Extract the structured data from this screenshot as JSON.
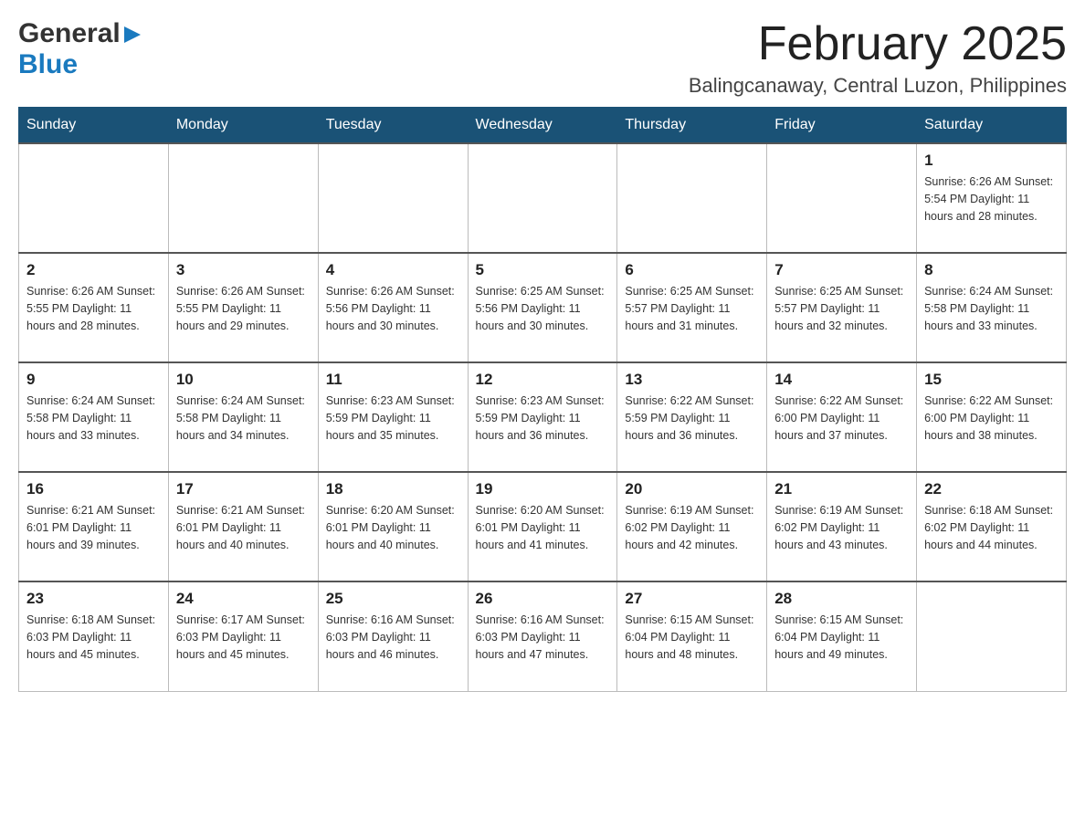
{
  "header": {
    "logo_general": "General",
    "logo_blue": "Blue",
    "month_title": "February 2025",
    "location": "Balingcanaway, Central Luzon, Philippines"
  },
  "days_of_week": [
    "Sunday",
    "Monday",
    "Tuesday",
    "Wednesday",
    "Thursday",
    "Friday",
    "Saturday"
  ],
  "weeks": [
    {
      "days": [
        {
          "number": "",
          "info": ""
        },
        {
          "number": "",
          "info": ""
        },
        {
          "number": "",
          "info": ""
        },
        {
          "number": "",
          "info": ""
        },
        {
          "number": "",
          "info": ""
        },
        {
          "number": "",
          "info": ""
        },
        {
          "number": "1",
          "info": "Sunrise: 6:26 AM\nSunset: 5:54 PM\nDaylight: 11 hours and 28 minutes."
        }
      ]
    },
    {
      "days": [
        {
          "number": "2",
          "info": "Sunrise: 6:26 AM\nSunset: 5:55 PM\nDaylight: 11 hours and 28 minutes."
        },
        {
          "number": "3",
          "info": "Sunrise: 6:26 AM\nSunset: 5:55 PM\nDaylight: 11 hours and 29 minutes."
        },
        {
          "number": "4",
          "info": "Sunrise: 6:26 AM\nSunset: 5:56 PM\nDaylight: 11 hours and 30 minutes."
        },
        {
          "number": "5",
          "info": "Sunrise: 6:25 AM\nSunset: 5:56 PM\nDaylight: 11 hours and 30 minutes."
        },
        {
          "number": "6",
          "info": "Sunrise: 6:25 AM\nSunset: 5:57 PM\nDaylight: 11 hours and 31 minutes."
        },
        {
          "number": "7",
          "info": "Sunrise: 6:25 AM\nSunset: 5:57 PM\nDaylight: 11 hours and 32 minutes."
        },
        {
          "number": "8",
          "info": "Sunrise: 6:24 AM\nSunset: 5:58 PM\nDaylight: 11 hours and 33 minutes."
        }
      ]
    },
    {
      "days": [
        {
          "number": "9",
          "info": "Sunrise: 6:24 AM\nSunset: 5:58 PM\nDaylight: 11 hours and 33 minutes."
        },
        {
          "number": "10",
          "info": "Sunrise: 6:24 AM\nSunset: 5:58 PM\nDaylight: 11 hours and 34 minutes."
        },
        {
          "number": "11",
          "info": "Sunrise: 6:23 AM\nSunset: 5:59 PM\nDaylight: 11 hours and 35 minutes."
        },
        {
          "number": "12",
          "info": "Sunrise: 6:23 AM\nSunset: 5:59 PM\nDaylight: 11 hours and 36 minutes."
        },
        {
          "number": "13",
          "info": "Sunrise: 6:22 AM\nSunset: 5:59 PM\nDaylight: 11 hours and 36 minutes."
        },
        {
          "number": "14",
          "info": "Sunrise: 6:22 AM\nSunset: 6:00 PM\nDaylight: 11 hours and 37 minutes."
        },
        {
          "number": "15",
          "info": "Sunrise: 6:22 AM\nSunset: 6:00 PM\nDaylight: 11 hours and 38 minutes."
        }
      ]
    },
    {
      "days": [
        {
          "number": "16",
          "info": "Sunrise: 6:21 AM\nSunset: 6:01 PM\nDaylight: 11 hours and 39 minutes."
        },
        {
          "number": "17",
          "info": "Sunrise: 6:21 AM\nSunset: 6:01 PM\nDaylight: 11 hours and 40 minutes."
        },
        {
          "number": "18",
          "info": "Sunrise: 6:20 AM\nSunset: 6:01 PM\nDaylight: 11 hours and 40 minutes."
        },
        {
          "number": "19",
          "info": "Sunrise: 6:20 AM\nSunset: 6:01 PM\nDaylight: 11 hours and 41 minutes."
        },
        {
          "number": "20",
          "info": "Sunrise: 6:19 AM\nSunset: 6:02 PM\nDaylight: 11 hours and 42 minutes."
        },
        {
          "number": "21",
          "info": "Sunrise: 6:19 AM\nSunset: 6:02 PM\nDaylight: 11 hours and 43 minutes."
        },
        {
          "number": "22",
          "info": "Sunrise: 6:18 AM\nSunset: 6:02 PM\nDaylight: 11 hours and 44 minutes."
        }
      ]
    },
    {
      "days": [
        {
          "number": "23",
          "info": "Sunrise: 6:18 AM\nSunset: 6:03 PM\nDaylight: 11 hours and 45 minutes."
        },
        {
          "number": "24",
          "info": "Sunrise: 6:17 AM\nSunset: 6:03 PM\nDaylight: 11 hours and 45 minutes."
        },
        {
          "number": "25",
          "info": "Sunrise: 6:16 AM\nSunset: 6:03 PM\nDaylight: 11 hours and 46 minutes."
        },
        {
          "number": "26",
          "info": "Sunrise: 6:16 AM\nSunset: 6:03 PM\nDaylight: 11 hours and 47 minutes."
        },
        {
          "number": "27",
          "info": "Sunrise: 6:15 AM\nSunset: 6:04 PM\nDaylight: 11 hours and 48 minutes."
        },
        {
          "number": "28",
          "info": "Sunrise: 6:15 AM\nSunset: 6:04 PM\nDaylight: 11 hours and 49 minutes."
        },
        {
          "number": "",
          "info": ""
        }
      ]
    }
  ]
}
